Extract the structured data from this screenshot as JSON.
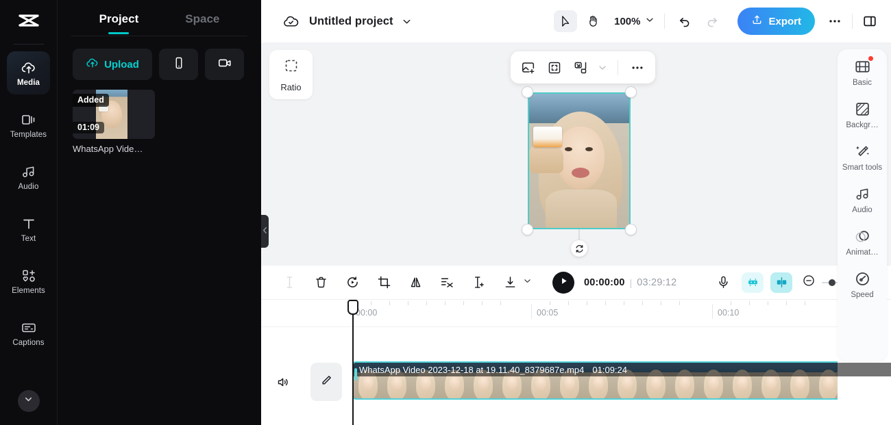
{
  "rail": {
    "logo_icon": "capcut-logo-icon",
    "items": [
      {
        "label": "Media",
        "icon": "cloud-upload-icon",
        "active": true
      },
      {
        "label": "Templates",
        "icon": "templates-icon",
        "active": false
      },
      {
        "label": "Audio",
        "icon": "music-note-icon",
        "active": false
      },
      {
        "label": "Text",
        "icon": "text-t-icon",
        "active": false
      },
      {
        "label": "Elements",
        "icon": "elements-icon",
        "active": false
      },
      {
        "label": "Captions",
        "icon": "captions-icon",
        "active": false
      }
    ],
    "more_icon": "chevron-down-icon"
  },
  "panel": {
    "tabs": [
      {
        "label": "Project",
        "active": true
      },
      {
        "label": "Space",
        "active": false
      }
    ],
    "upload_label": "Upload",
    "upload_icon": "cloud-upload-icon",
    "device_icon": "phone-icon",
    "record_icon": "video-camera-icon",
    "media": [
      {
        "status_badge": "Added",
        "duration_badge": "01:09",
        "name": "WhatsApp Vide…"
      }
    ]
  },
  "topbar": {
    "cloud_icon": "cloud-check-icon",
    "project_title": "Untitled project",
    "title_caret_icon": "chevron-down-icon",
    "select_tool_icon": "cursor-arrow-icon",
    "hand_tool_icon": "hand-icon",
    "zoom_level": "100%",
    "zoom_caret_icon": "chevron-down-icon",
    "undo_icon": "undo-icon",
    "redo_icon": "redo-icon",
    "export_label": "Export",
    "export_icon": "export-upload-icon",
    "more_icon": "ellipsis-icon",
    "panel_toggle_icon": "split-panel-icon",
    "accent_color": "#22b8e6",
    "export_gradient_from": "#3b82f6",
    "export_gradient_to": "#22b8e6"
  },
  "stage": {
    "ratio_label": "Ratio",
    "ratio_icon": "crop-dashed-icon",
    "float_tools": [
      {
        "icon": "add-image-icon",
        "name": "replace-media"
      },
      {
        "icon": "fit-to-frame-icon",
        "name": "fit-frame"
      },
      {
        "icon": "picture-in-picture-icon",
        "name": "pip"
      },
      {
        "icon": "chevron-down-icon",
        "name": "pip-dropdown"
      },
      {
        "icon": "ellipsis-icon",
        "name": "more-options"
      }
    ],
    "selection_color": "#4ecdc9",
    "rotate_icon": "rotate-icon",
    "collapse_icon": "chevron-left-icon"
  },
  "timeline_toolbar": {
    "tools": [
      {
        "icon": "split-cursor-icon",
        "name": "split",
        "disabled": true
      },
      {
        "icon": "trash-icon",
        "name": "delete",
        "disabled": false
      },
      {
        "icon": "reverse-icon",
        "name": "reverse",
        "disabled": false
      },
      {
        "icon": "crop-icon",
        "name": "crop",
        "disabled": false
      },
      {
        "icon": "mirror-icon",
        "name": "mirror",
        "disabled": false
      },
      {
        "icon": "cut-scissors-icon",
        "name": "cut-out",
        "disabled": false
      },
      {
        "icon": "freeze-frame-icon",
        "name": "freeze",
        "disabled": false
      },
      {
        "icon": "download-icon",
        "name": "download",
        "disabled": false
      }
    ],
    "download_caret_icon": "chevron-down-icon",
    "play_icon": "play-icon",
    "current_time": "00:00:00",
    "time_separator": "|",
    "total_time": "03:29:12",
    "mic_icon": "microphone-icon",
    "auto_captions_icon": "auto-captions-icon",
    "split-audio_icon": "split-audio-icon",
    "zoom_out_icon": "minus-circle-icon",
    "zoom_in_icon": "plus-circle-icon"
  },
  "timeline": {
    "ruler_labels": [
      "00:00",
      "00:05",
      "00:10"
    ],
    "mute_icon": "speaker-icon",
    "edit_icon": "pencil-icon",
    "clip": {
      "title": "WhatsApp Video 2023-12-18 at 19.11.40_8379687e.mp4",
      "duration": "01:09:24",
      "border_color": "#4ed0d6"
    },
    "playhead_position": "00:00"
  },
  "dock": {
    "items": [
      {
        "label": "Basic",
        "icon": "filmstrip-icon",
        "badge": true
      },
      {
        "label": "Backgr…",
        "icon": "background-icon",
        "badge": false
      },
      {
        "label": "Smart tools",
        "icon": "magic-wand-icon",
        "badge": false
      },
      {
        "label": "Audio",
        "icon": "music-note-icon",
        "badge": false
      },
      {
        "label": "Animat…",
        "icon": "animation-circles-icon",
        "badge": false
      },
      {
        "label": "Speed",
        "icon": "speedometer-icon",
        "badge": false
      }
    ],
    "badge_color": "#ff3b30"
  }
}
